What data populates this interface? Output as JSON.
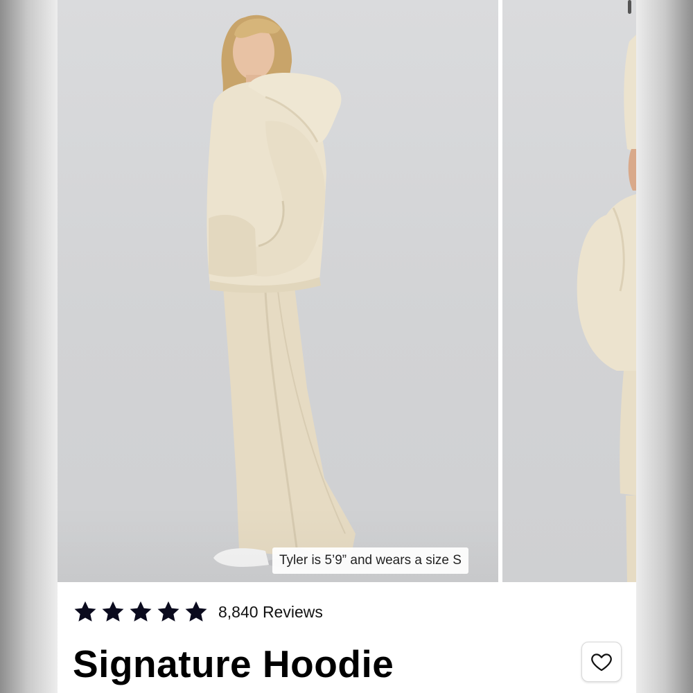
{
  "product": {
    "title": "Signature Hoodie",
    "rating_stars": 5,
    "reviews_label": "8,840 Reviews"
  },
  "carousel": {
    "caption": "Tyler is 5’9” and wears a size S"
  },
  "icons": {
    "star": "star-icon",
    "wishlist": "heart-outline-icon"
  },
  "colors": {
    "garment": "#e9dfc9",
    "star": "#0b0b1e",
    "background": "#d6d7d9"
  }
}
